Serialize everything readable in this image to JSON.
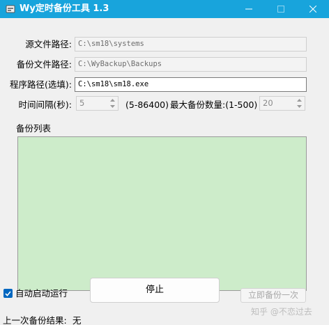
{
  "window": {
    "title": "Wy定时备份工具 1.3",
    "colors": {
      "titlebar": "#18a4dc",
      "list_background": "#cdecca",
      "checkbox": "#0067c0"
    }
  },
  "form": {
    "source_path": {
      "label": "源文件路径:",
      "value": "C:\\sm18\\systems"
    },
    "backup_path": {
      "label": "备份文件路径:",
      "value": "C:\\WyBackup\\Backups"
    },
    "program_path": {
      "label": "程序路径(选填):",
      "value": "C:\\sm18\\sm18.exe"
    },
    "interval": {
      "label": "时间间隔(秒):",
      "value": "5",
      "range_hint": "(5-86400)"
    },
    "max_backups": {
      "label": "最大备份数量:(1-500)",
      "value": "20"
    }
  },
  "backup_list": {
    "label": "备份列表"
  },
  "footer": {
    "auto_start": {
      "label": "自动启动运行",
      "checked": true
    },
    "stop_label": "停止",
    "backup_now_label": "立即备份一次",
    "last_result_label": "上一次备份结果:",
    "last_result_value": "无"
  },
  "watermark": "知乎 @不恋过去"
}
